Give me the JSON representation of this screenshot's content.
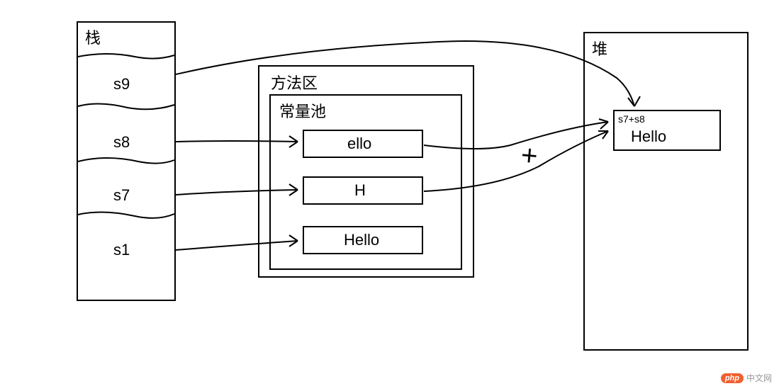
{
  "stack": {
    "title": "栈",
    "items": [
      "s9",
      "s8",
      "s7",
      "s1"
    ]
  },
  "method_area": {
    "title": "方法区",
    "constant_pool": {
      "title": "常量池",
      "items": [
        "ello",
        "H",
        "Hello"
      ]
    }
  },
  "heap": {
    "title": "堆",
    "object": {
      "label": "s7+s8",
      "value": "Hello"
    }
  },
  "operator": "+",
  "watermark": {
    "badge": "php",
    "text": "中文网"
  }
}
